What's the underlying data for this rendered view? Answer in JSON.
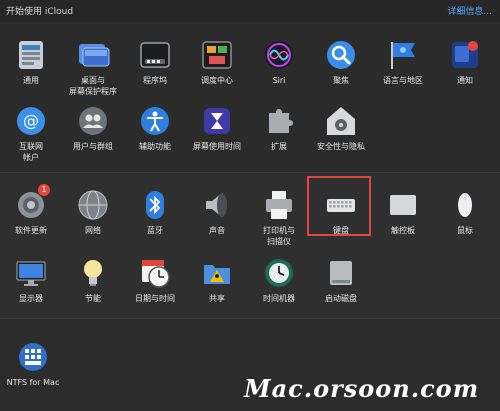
{
  "header": {
    "title": "开始使用 iCloud",
    "detail_link": "详细信息..."
  },
  "row1": [
    {
      "label": "通用",
      "icon": "general-icon"
    },
    {
      "label": "桌面与\n屏幕保护程序",
      "icon": "desktop-screensaver-icon"
    },
    {
      "label": "程序坞",
      "icon": "dock-icon"
    },
    {
      "label": "调度中心",
      "icon": "mission-control-icon"
    },
    {
      "label": "Siri",
      "icon": "siri-icon"
    },
    {
      "label": "聚焦",
      "icon": "spotlight-icon"
    },
    {
      "label": "语言与地区",
      "icon": "language-region-icon"
    },
    {
      "label": "通知",
      "icon": "notifications-icon"
    }
  ],
  "row2": [
    {
      "label": "互联网\n帐户",
      "icon": "internet-accounts-icon"
    },
    {
      "label": "用户与群组",
      "icon": "users-groups-icon"
    },
    {
      "label": "辅助功能",
      "icon": "accessibility-icon"
    },
    {
      "label": "屏幕使用时间",
      "icon": "screen-time-icon"
    },
    {
      "label": "扩展",
      "icon": "extensions-icon"
    },
    {
      "label": "安全性与隐私",
      "icon": "security-privacy-icon"
    }
  ],
  "row3": [
    {
      "label": "软件更新",
      "icon": "software-update-icon",
      "badge": "1"
    },
    {
      "label": "网络",
      "icon": "network-icon"
    },
    {
      "label": "蓝牙",
      "icon": "bluetooth-icon"
    },
    {
      "label": "声音",
      "icon": "sound-icon"
    },
    {
      "label": "打印机与\n扫描仪",
      "icon": "printers-scanners-icon"
    },
    {
      "label": "键盘",
      "icon": "keyboard-icon"
    },
    {
      "label": "触控板",
      "icon": "trackpad-icon"
    },
    {
      "label": "鼠标",
      "icon": "mouse-icon"
    }
  ],
  "row4": [
    {
      "label": "显示器",
      "icon": "displays-icon"
    },
    {
      "label": "节能",
      "icon": "energy-saver-icon"
    },
    {
      "label": "日期与时间",
      "icon": "date-time-icon"
    },
    {
      "label": "共享",
      "icon": "sharing-icon"
    },
    {
      "label": "时间机器",
      "icon": "time-machine-icon"
    },
    {
      "label": "启动磁盘",
      "icon": "startup-disk-icon"
    }
  ],
  "row5": [
    {
      "label": "NTFS for Mac",
      "icon": "ntfs-for-mac-icon"
    }
  ],
  "watermark": "Mac.orsoon.com",
  "colors": {
    "background": "#2a2a2b",
    "highlight": "#e0463c",
    "link": "#5aa6ff"
  }
}
